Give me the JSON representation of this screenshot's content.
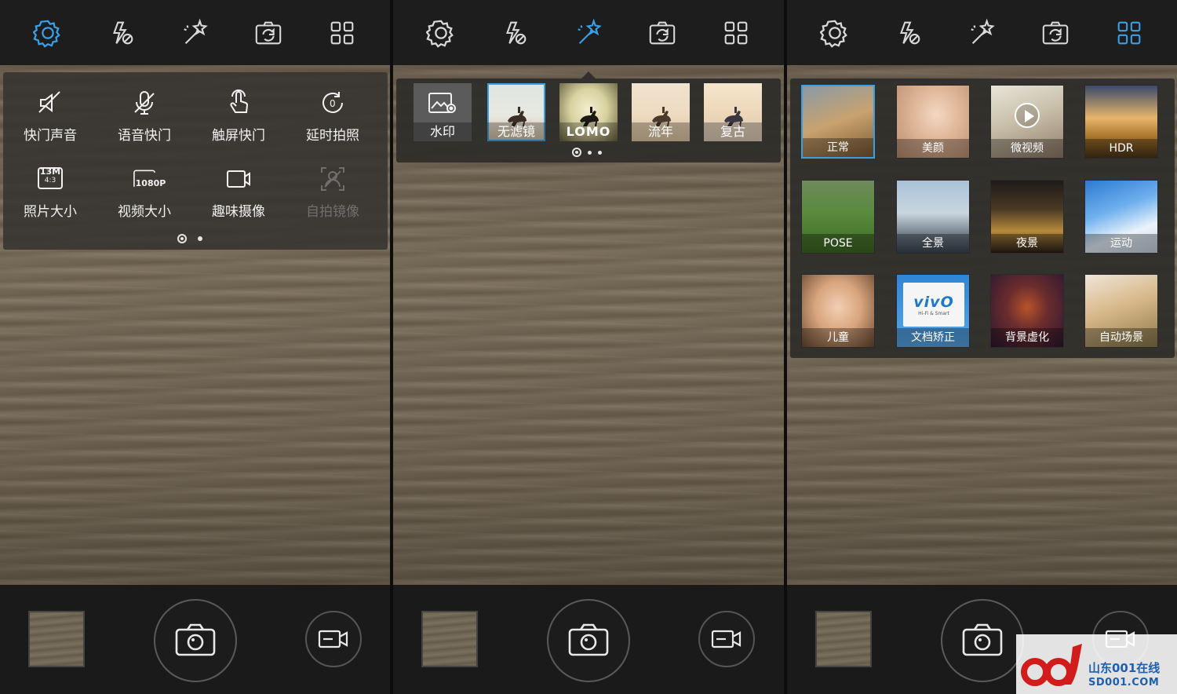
{
  "colors": {
    "accent": "#3aa0e6",
    "icon": "#d9d9d9",
    "disabled": "#6f6f6f",
    "panel": "#2e2c29"
  },
  "topbar_icons": [
    "settings-gear-icon",
    "flash-off-icon",
    "magic-wand-icon",
    "switch-camera-icon",
    "mode-grid-icon"
  ],
  "screen1": {
    "active_tab": "settings",
    "settings": [
      {
        "label": "快门声音",
        "icon": "shutter-sound-off-icon",
        "enabled": true
      },
      {
        "label": "语音快门",
        "icon": "voice-shutter-mic-icon",
        "enabled": true
      },
      {
        "label": "触屏快门",
        "icon": "touch-shutter-icon",
        "enabled": true
      },
      {
        "label": "延时拍照",
        "icon": "self-timer-icon",
        "enabled": true
      },
      {
        "label": "照片大小",
        "icon": "photo-size-icon",
        "enabled": true
      },
      {
        "label": "视频大小",
        "icon": "video-size-icon",
        "enabled": true
      },
      {
        "label": "趣味摄像",
        "icon": "fun-video-icon",
        "enabled": true
      },
      {
        "label": "自拍镜像",
        "icon": "selfie-mirror-icon",
        "enabled": false
      }
    ],
    "photo_size_badge": {
      "top": "13M",
      "bottom": "4:3"
    },
    "video_size_badge": "1080P",
    "pager": {
      "pages": 2,
      "current": 1
    }
  },
  "screen2": {
    "active_tab": "filters",
    "filters": [
      {
        "label": "水印",
        "kind": "watermark"
      },
      {
        "label": "无滤镜",
        "kind": "photo",
        "selected": true
      },
      {
        "label": "LOMO",
        "kind": "photo"
      },
      {
        "label": "流年",
        "kind": "photo"
      },
      {
        "label": "复古",
        "kind": "photo"
      }
    ],
    "pager": {
      "pages": 3,
      "current": 1
    }
  },
  "screen3": {
    "active_tab": "modes",
    "modes": [
      {
        "label": "正常",
        "selected": true
      },
      {
        "label": "美颜"
      },
      {
        "label": "微视频"
      },
      {
        "label": "HDR"
      },
      {
        "label": "POSE"
      },
      {
        "label": "全景"
      },
      {
        "label": "夜景"
      },
      {
        "label": "运动"
      },
      {
        "label": "儿童"
      },
      {
        "label": "文档矫正"
      },
      {
        "label": "背景虚化"
      },
      {
        "label": "自动场景"
      }
    ],
    "doc_card": {
      "brand": "vivO",
      "tag": "Hi-Fi & Smart"
    }
  },
  "bottom": {
    "shutter": "camera-shutter-icon",
    "video": "video-record-icon"
  },
  "watermark": {
    "cn": "山东001在线",
    "url": "SD001.COM"
  }
}
